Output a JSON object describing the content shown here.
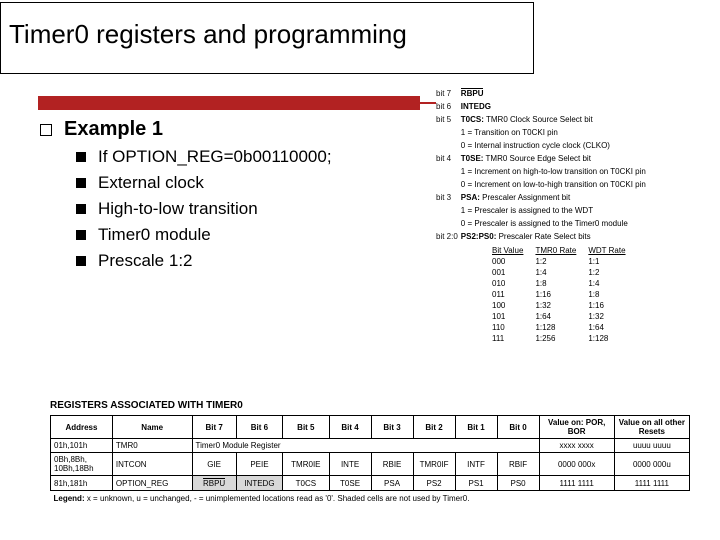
{
  "title": "Timer0 registers and programming",
  "example": {
    "heading": "Example 1",
    "items": [
      "If OPTION_REG=0b00110000;",
      "External clock",
      "High-to-low transition",
      "Timer0 module",
      "Prescale 1:2"
    ]
  },
  "option_reg_bits": {
    "rows": [
      {
        "bit": "bit 7",
        "name": "RBPU",
        "overline": true,
        "desc": ""
      },
      {
        "bit": "bit 6",
        "name": "INTEDG",
        "desc": ""
      },
      {
        "bit": "bit 5",
        "name": "T0CS:",
        "desc": "TMR0 Clock Source Select bit",
        "subs": [
          "1 = Transition on T0CKI pin",
          "0 = Internal instruction cycle clock (CLKO)"
        ]
      },
      {
        "bit": "bit 4",
        "name": "T0SE:",
        "desc": "TMR0 Source Edge Select bit",
        "subs": [
          "1 = Increment on high-to-low transition on T0CKI pin",
          "0 = Increment on low-to-high transition on T0CKI pin"
        ]
      },
      {
        "bit": "bit 3",
        "name": "PSA:",
        "desc": "Prescaler Assignment bit",
        "subs": [
          "1 = Prescaler is assigned to the WDT",
          "0 = Prescaler is assigned to the Timer0 module"
        ]
      },
      {
        "bit": "bit 2:0",
        "name": "PS2:PS0:",
        "desc": "Prescaler Rate Select bits"
      }
    ],
    "prescale": {
      "headers": [
        "Bit Value",
        "TMR0 Rate",
        "WDT Rate"
      ],
      "rows": [
        [
          "000",
          "1:2",
          "1:1"
        ],
        [
          "001",
          "1:4",
          "1:2"
        ],
        [
          "010",
          "1:8",
          "1:4"
        ],
        [
          "011",
          "1:16",
          "1:8"
        ],
        [
          "100",
          "1:32",
          "1:16"
        ],
        [
          "101",
          "1:64",
          "1:32"
        ],
        [
          "110",
          "1:128",
          "1:64"
        ],
        [
          "111",
          "1:256",
          "1:128"
        ]
      ]
    }
  },
  "assoc_table": {
    "title": "REGISTERS ASSOCIATED WITH TIMER0",
    "headers": [
      "Address",
      "Name",
      "Bit 7",
      "Bit 6",
      "Bit 5",
      "Bit 4",
      "Bit 3",
      "Bit 2",
      "Bit 1",
      "Bit 0",
      "Value on: POR, BOR",
      "Value on all other Resets"
    ],
    "rows": [
      {
        "addr": "01h,101h",
        "name": "TMR0",
        "bits_colspan": "Timer0 Module Register",
        "por": "xxxx xxxx",
        "other": "uuuu uuuu",
        "shade_por": false,
        "shade_other": false
      },
      {
        "addr": "0Bh,8Bh, 10Bh,18Bh",
        "name": "INTCON",
        "bits": [
          "GIE",
          "PEIE",
          "TMR0IE",
          "INTE",
          "RBIE",
          "TMR0IF",
          "INTF",
          "RBIF"
        ],
        "por": "0000 000x",
        "other": "0000 000u"
      },
      {
        "addr": "81h,181h",
        "name": "OPTION_REG",
        "bits": [
          "RBPU",
          "INTEDG",
          "T0CS",
          "T0SE",
          "PSA",
          "PS2",
          "PS1",
          "PS0"
        ],
        "shade_bits": [
          0,
          1
        ],
        "por": "1111 1111",
        "other": "1111 1111"
      }
    ],
    "legend": "Legend:  x = unknown, u = unchanged, - = unimplemented locations read as '0'. Shaded cells are not used by Timer0."
  }
}
